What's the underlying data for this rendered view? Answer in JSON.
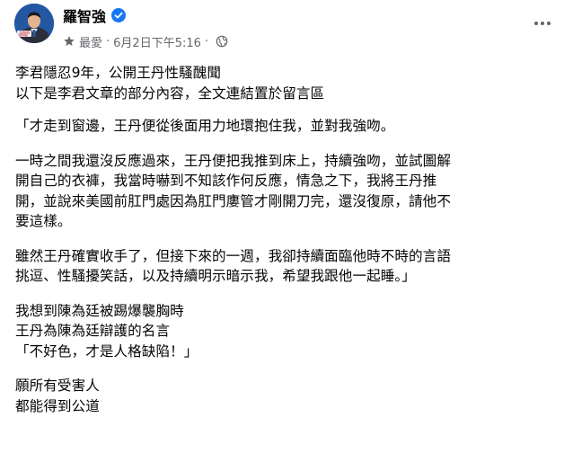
{
  "header": {
    "author_name": "羅智強",
    "favorite_label": "最愛",
    "separator": "·",
    "timestamp": "6月2日下午5:16",
    "separator2": "·",
    "more_icon": "more-horizontal-icon",
    "verified_icon": "verified-badge-icon",
    "privacy_icon": "globe-icon",
    "favorite_icon": "star-icon",
    "accent_color": "#1877f2",
    "avatar_text_line1": "大家好我",
    "avatar_text_line2": "羅智強！"
  },
  "post": {
    "paragraphs": [
      "李君隱忍9年，公開王丹性騷醜聞\n以下是李君文章的部分內容，全文連結置於留言區",
      "「才走到窗邊，王丹便從後面用力地環抱住我，並對我強吻。",
      "一時之間我還沒反應過來，王丹便把我推到床上，持續強吻，並試圖解\n開自己的衣褲，我當時嚇到不知該作何反應，情急之下，我將王丹推\n開，並說來美國前肛門處因為肛門廔管才剛開刀完，還沒復原，請他不\n要這樣。",
      "雖然王丹確實收手了，但接下來的一週，我卻持續面臨他時不時的言語\n挑逗、性騷擾笑話，以及持續明示暗示我，希望我跟他一起睡。」",
      "我想到陳為廷被踢爆襲胸時\n王丹為陳為廷辯護的名言\n「不好色，才是人格缺陷！」",
      "願所有受害人\n都能得到公道"
    ]
  }
}
